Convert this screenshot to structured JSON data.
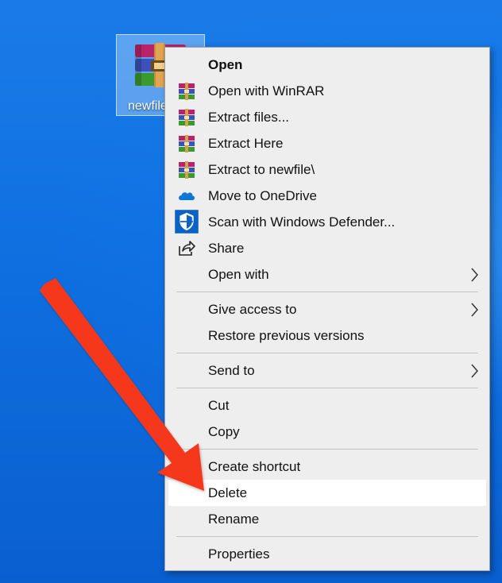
{
  "desktop": {
    "file_icon": {
      "label": "newfile",
      "icon": "winrar-archive-icon"
    }
  },
  "context_menu": {
    "items": [
      {
        "label": "Open",
        "icon": "",
        "bold": true,
        "submenu": false
      },
      {
        "label": "Open with WinRAR",
        "icon": "winrar-icon",
        "submenu": false
      },
      {
        "label": "Extract files...",
        "icon": "winrar-icon",
        "submenu": false
      },
      {
        "label": "Extract Here",
        "icon": "winrar-icon",
        "submenu": false
      },
      {
        "label": "Extract to newfile\\",
        "icon": "winrar-icon",
        "submenu": false
      },
      {
        "label": "Move to OneDrive",
        "icon": "onedrive-cloud-icon",
        "submenu": false
      },
      {
        "label": "Scan with Windows Defender...",
        "icon": "windows-defender-shield-icon",
        "submenu": false
      },
      {
        "label": "Share",
        "icon": "share-icon",
        "submenu": false
      },
      {
        "label": "Open with",
        "icon": "",
        "submenu": true
      },
      {
        "label": "Give access to",
        "icon": "",
        "submenu": true
      },
      {
        "label": "Restore previous versions",
        "icon": "",
        "submenu": false
      },
      {
        "label": "Send to",
        "icon": "",
        "submenu": true
      },
      {
        "label": "Cut",
        "icon": "",
        "submenu": false
      },
      {
        "label": "Copy",
        "icon": "",
        "submenu": false
      },
      {
        "label": "Create shortcut",
        "icon": "",
        "submenu": false
      },
      {
        "label": "Delete",
        "icon": "",
        "submenu": false,
        "highlighted": true
      },
      {
        "label": "Rename",
        "icon": "",
        "submenu": false
      },
      {
        "label": "Properties",
        "icon": "",
        "submenu": false
      }
    ]
  },
  "annotation": {
    "arrow_color": "#f5391e",
    "points_to": "Delete"
  },
  "colors": {
    "menu_background": "#eeeeee",
    "menu_highlight": "#ffffff",
    "desktop_blue": "#0f6fe0"
  }
}
